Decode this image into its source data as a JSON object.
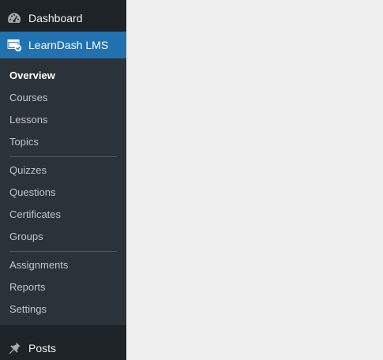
{
  "sidebar": {
    "background": "#1d2327",
    "submenu_background": "#2c3338",
    "active_color": "#2271b1",
    "menu": [
      {
        "label": "Dashboard",
        "icon": "dashboard-gauge-icon"
      },
      {
        "label": "LearnDash LMS",
        "icon": "learndash-icon",
        "active": true
      },
      {
        "label": "Posts",
        "icon": "pushpin-icon"
      }
    ],
    "learndash_submenu": [
      {
        "label": "Overview",
        "current": true
      },
      {
        "label": "Courses"
      },
      {
        "label": "Lessons"
      },
      {
        "label": "Topics"
      },
      {
        "label": "Quizzes"
      },
      {
        "label": "Questions"
      },
      {
        "label": "Certificates"
      },
      {
        "label": "Groups"
      },
      {
        "label": "Assignments"
      },
      {
        "label": "Reports"
      },
      {
        "label": "Settings"
      }
    ]
  }
}
